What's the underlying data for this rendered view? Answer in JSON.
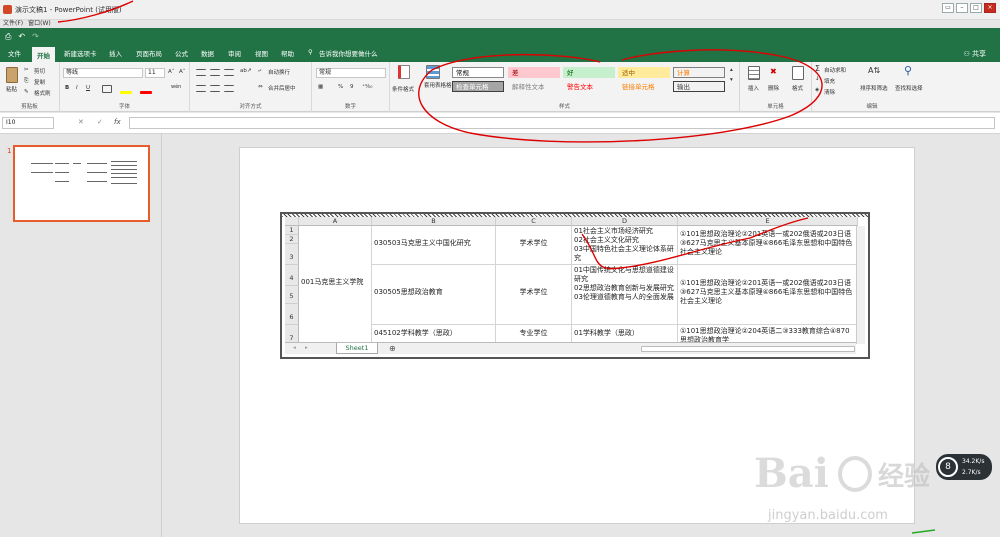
{
  "window": {
    "title": "演示文稿1 - PowerPoint (试用版)",
    "menu": [
      "文件(F)",
      "窗口(W)"
    ],
    "controls": [
      "▭",
      "–",
      "□",
      "×"
    ]
  },
  "qat": {
    "save": "⎙",
    "undo": "↶",
    "redo": "↷"
  },
  "tabs": [
    {
      "label": "文件"
    },
    {
      "label": "开始"
    },
    {
      "label": "新建选项卡"
    },
    {
      "label": "插入"
    },
    {
      "label": "页面布局"
    },
    {
      "label": "公式"
    },
    {
      "label": "数据"
    },
    {
      "label": "审阅"
    },
    {
      "label": "视图"
    },
    {
      "label": "帮助"
    }
  ],
  "tellme": "告诉我你想要做什么",
  "share": "共享",
  "ribbon": {
    "clipboard": {
      "paste": "粘贴",
      "cut": "剪切",
      "copy": "复制",
      "format_painter": "格式刷",
      "label": "剪贴板"
    },
    "font": {
      "name": "等线",
      "size": "11",
      "grow": "A˄",
      "shrink": "A˅",
      "bold": "B",
      "italic": "I",
      "underline": "U",
      "wen": "wén",
      "label": "字体"
    },
    "alignment": {
      "wrap": "自动换行",
      "merge": "合并后居中",
      "label": "对齐方式"
    },
    "number": {
      "format": "常规",
      "percent": "%",
      "comma": "9",
      "label": "数字"
    },
    "styles": {
      "conditional": "条件格式",
      "table_format": "套用表格格式",
      "cells": [
        {
          "label": "常规",
          "bg": "#ffffff",
          "fg": "#000000",
          "border": "#888888"
        },
        {
          "label": "差",
          "bg": "#ffc7ce",
          "fg": "#9c0006",
          "border": "#ffc7ce"
        },
        {
          "label": "好",
          "bg": "#c6efce",
          "fg": "#006100",
          "border": "#c6efce"
        },
        {
          "label": "适中",
          "bg": "#ffeb9c",
          "fg": "#9c5700",
          "border": "#ffeb9c"
        },
        {
          "label": "计算",
          "bg": "#f2f2f2",
          "fg": "#fa7d00",
          "border": "#7f7f7f"
        },
        {
          "label": "检查单元格",
          "bg": "#a5a5a5",
          "fg": "#ffffff",
          "border": "#3f3f3f"
        },
        {
          "label": "解释性文本",
          "bg": "#f3f3f3",
          "fg": "#7f7f7f",
          "border": "#f3f3f3"
        },
        {
          "label": "警告文本",
          "bg": "#f3f3f3",
          "fg": "#ff0000",
          "border": "#f3f3f3"
        },
        {
          "label": "链接单元格",
          "bg": "#f3f3f3",
          "fg": "#fa7d00",
          "border": "#f3f3f3"
        },
        {
          "label": "输出",
          "bg": "#f2f2f2",
          "fg": "#3f3f3f",
          "border": "#3f3f3f"
        }
      ],
      "label": "样式"
    },
    "cells": {
      "insert": "插入",
      "delete": "删除",
      "format": "格式",
      "label": "单元格"
    },
    "editing": {
      "autosum": "自动求和",
      "fill": "填充",
      "clear": "清除",
      "sort": "排序和筛选",
      "find": "查找和选择",
      "label": "编辑"
    }
  },
  "formula_bar": {
    "name_box": "I10",
    "cancel": "✕",
    "enter": "✓",
    "fx": "fx",
    "value": ""
  },
  "slide_pane": {
    "slide_number": "1"
  },
  "sheet": {
    "columns": [
      "A",
      "B",
      "C",
      "D",
      "E"
    ],
    "rows": [
      "1",
      "2",
      "3",
      "4",
      "5",
      "6",
      "7"
    ],
    "college": "001马克思主义学院",
    "groups": [
      {
        "major": "030503马克思主义中国化研究",
        "degree": "学术学位",
        "directions": [
          "01社会主义市场经济研究",
          "02社会主义文化研究",
          "03中国特色社会主义理论体系研究"
        ],
        "exams": "①101思想政治理论②201英语一或202俄语或203日语③627马克思主义基本原理④866毛泽东思想和中国特色社会主义理论"
      },
      {
        "major": "030505思想政治教育",
        "degree": "学术学位",
        "directions": [
          "01中国传统文化与思想道德建设研究",
          "02思想政治教育创新与发展研究",
          "03伦理道德教育与人的全面发展"
        ],
        "exams": "①101思想政治理论②201英语一或202俄语或203日语③627马克思主义基本原理④866毛泽东思想和中国特色社会主义理论"
      },
      {
        "major": "045102学科教学（思政）",
        "degree": "专业学位",
        "directions": [
          "01学科教学（思政）"
        ],
        "exams": "①101思想政治理论②204英语二③333教育综合④870思想政治教育学"
      }
    ],
    "sheet_tab": "Sheet1",
    "add_sheet": "⊕"
  },
  "watermark": {
    "brand": "Bai",
    "brand_tail": "经验",
    "url": "jingyan.baidu.com"
  },
  "netwidget": {
    "percent": "8",
    "up": "34.2K/s",
    "down": "2.7K/s"
  }
}
